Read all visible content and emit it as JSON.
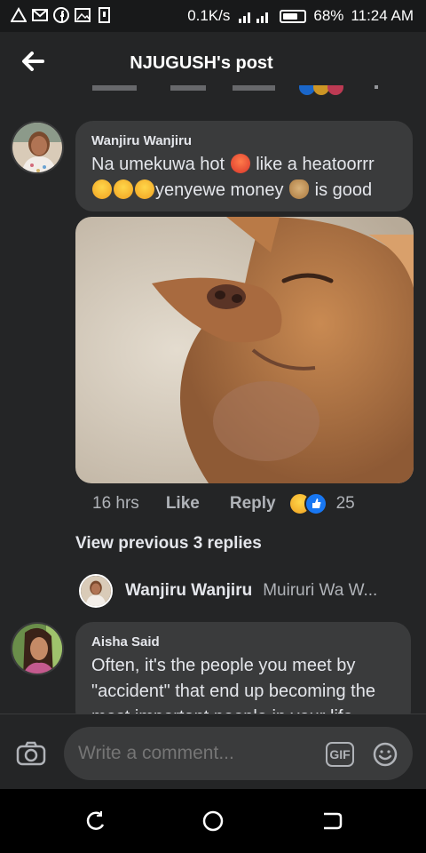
{
  "status_bar": {
    "speed": "0.1K/s",
    "battery": "68%",
    "time": "11:24 AM",
    "icons": [
      "alert-icon",
      "gmail-icon",
      "facebook-icon",
      "gallery-icon",
      "sim-icon"
    ]
  },
  "header": {
    "title": "NJUGUSH's post"
  },
  "comment1": {
    "author": "Wanjiru Wanjiru",
    "line1": "Na umekuwa hot",
    "line1b": "like a heatoorrr",
    "line2": "yenyewe money",
    "line2b": "is good"
  },
  "comment1_actions": {
    "time": "16 hrs",
    "like": "Like",
    "reply": "Reply",
    "reaction_count": "25"
  },
  "view_previous": "View previous 3 replies",
  "reply_preview": {
    "author": "Wanjiru Wanjiru",
    "text": "Muiruri Wa W..."
  },
  "comment2": {
    "author": "Aisha Said",
    "text": "Often, it's the people you meet by \"accident\" that end up becoming the most important people in your life"
  },
  "composer": {
    "placeholder": "Write a comment...",
    "gif": "GIF"
  },
  "colors": {
    "background": "#242526",
    "bubble": "#3a3b3c",
    "secondary_text": "#b0b3b8",
    "like_blue": "#1877f2",
    "haha_yellow": "#f7b125"
  }
}
